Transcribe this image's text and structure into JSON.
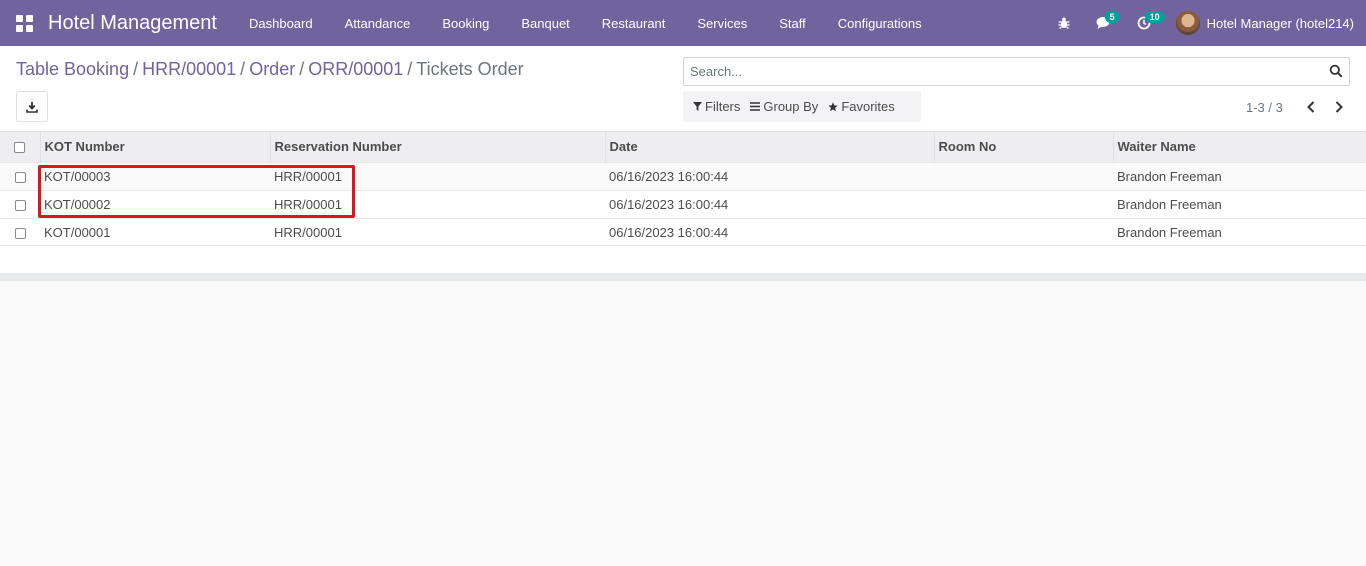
{
  "navbar": {
    "brand": "Hotel Management",
    "menu": [
      "Dashboard",
      "Attandance",
      "Booking",
      "Banquet",
      "Restaurant",
      "Services",
      "Staff",
      "Configurations"
    ],
    "messages_count": "5",
    "activities_count": "10",
    "user_name": "Hotel Manager (hotel214)"
  },
  "breadcrumb": {
    "items": [
      "Table Booking",
      "HRR/00001",
      "Order",
      "ORR/00001"
    ],
    "separator": "/",
    "current": "Tickets Order"
  },
  "search": {
    "placeholder": "Search..."
  },
  "filters": {
    "filters_label": "Filters",
    "group_by_label": "Group By",
    "favorites_label": "Favorites"
  },
  "pager": {
    "value": "1-3 / 3"
  },
  "table": {
    "columns": [
      "KOT Number",
      "Reservation Number",
      "Date",
      "Room No",
      "Waiter Name"
    ],
    "rows": [
      {
        "kot": "KOT/00003",
        "reservation": "HRR/00001",
        "date": "06/16/2023 16:00:44",
        "room": "",
        "waiter": "Brandon Freeman"
      },
      {
        "kot": "KOT/00002",
        "reservation": "HRR/00001",
        "date": "06/16/2023 16:00:44",
        "room": "",
        "waiter": "Brandon Freeman"
      },
      {
        "kot": "KOT/00001",
        "reservation": "HRR/00001",
        "date": "06/16/2023 16:00:44",
        "room": "",
        "waiter": "Brandon Freeman"
      }
    ]
  },
  "colors": {
    "navbar": "#71639e",
    "link": "#71639e",
    "badge": "#00a09d",
    "highlight": "#e0141e"
  },
  "icons": [
    "apps-icon",
    "bug-icon",
    "chat-icon",
    "clock-icon",
    "download-icon",
    "search-icon",
    "filter-icon",
    "group-by-icon",
    "star-icon",
    "chevron-left-icon",
    "chevron-right-icon"
  ]
}
